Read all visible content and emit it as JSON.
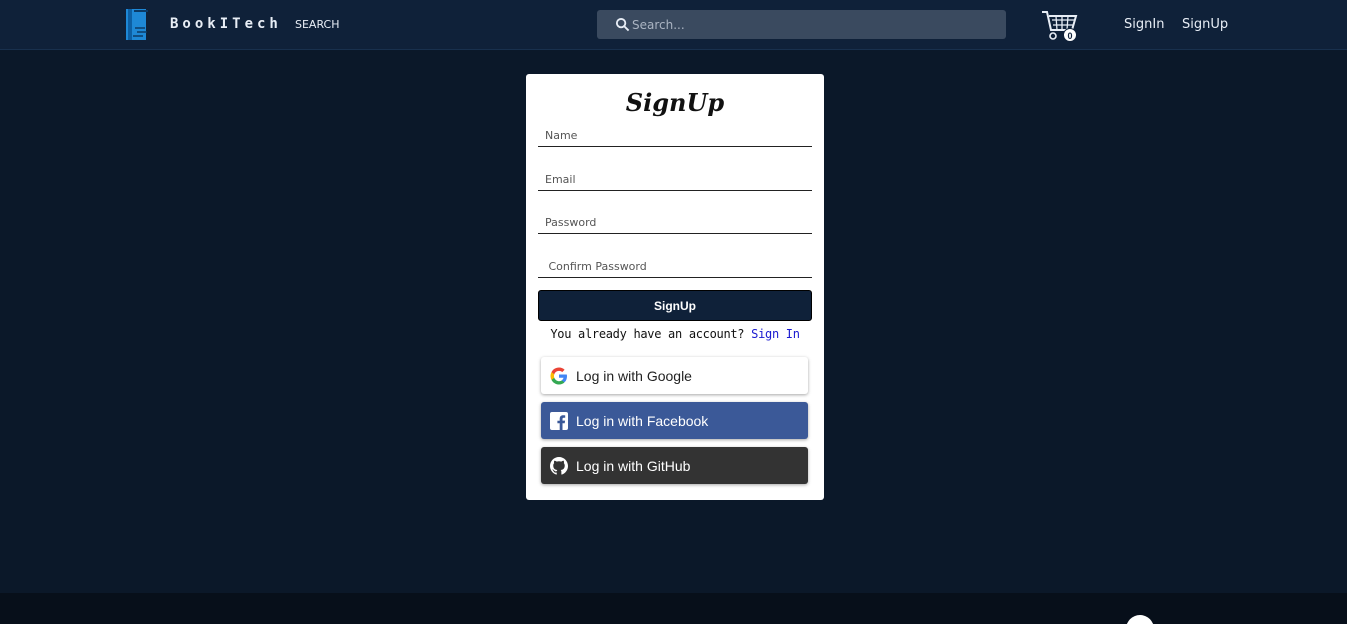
{
  "header": {
    "brand": "BookITech",
    "search_link": "SEARCH",
    "search_placeholder": "Search...",
    "cart_count": "0",
    "signin": "SignIn",
    "signup": "SignUp"
  },
  "form": {
    "title": "SignUp",
    "name_placeholder": "Name",
    "email_placeholder": "Email",
    "password_placeholder": "Password",
    "confirm_placeholder": " Confirm Password",
    "submit_label": "SignUp",
    "account_text": "You already have an account?",
    "signin_link": "Sign In",
    "google_label": "Log in with Google",
    "facebook_label": "Log in with Facebook",
    "github_label": "Log in with GitHub"
  },
  "colors": {
    "background": "#0b1829",
    "header": "#0f2139",
    "accent": "#0f2139",
    "facebook": "#3b5998",
    "github": "#333333",
    "link": "#1a1ad0"
  }
}
